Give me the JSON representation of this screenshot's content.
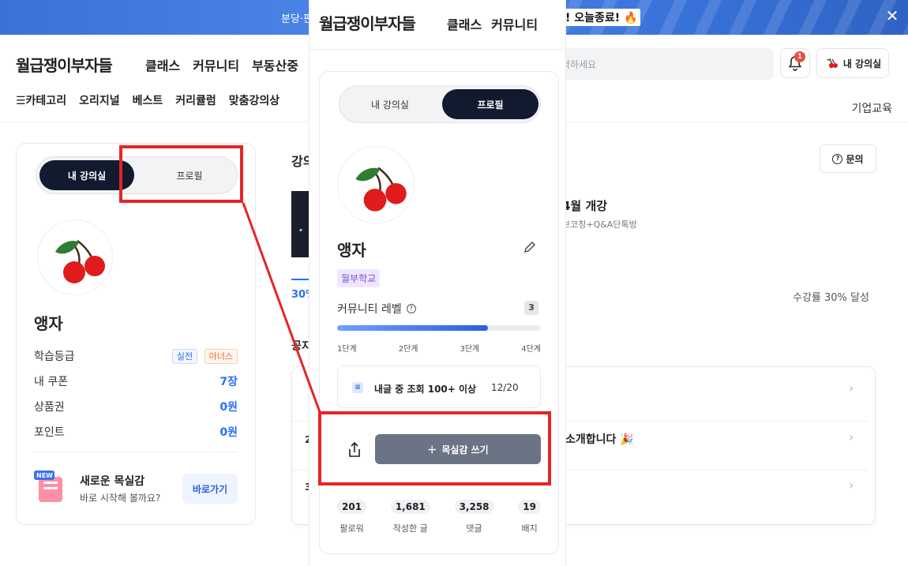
{
  "banner": {
    "left_text": "분당·판",
    "right_text": "! 오늘종료! 🔥",
    "close_label": "✕"
  },
  "header": {
    "logo": "월급쟁이부자들",
    "nav": [
      "클래스",
      "커뮤니티",
      "부동산중"
    ],
    "search_placeholder": "입력하세요",
    "notif_count": "1",
    "myroom_label": "내 강의실"
  },
  "subnav": {
    "items": [
      "☰카테고리",
      "오리지널",
      "베스트",
      "커리큘럼",
      "맞춤강의상"
    ],
    "right": "기업교육"
  },
  "left_card": {
    "toggle": {
      "active": "내 강의실",
      "inactive": "프로필"
    },
    "name": "앵자",
    "rows": [
      {
        "label": "학습등급",
        "badges": [
          "실전",
          "아너스"
        ]
      },
      {
        "label": "내 쿠폰",
        "value": "7장"
      },
      {
        "label": "상품권",
        "value": "0원"
      },
      {
        "label": "포인트",
        "value": "0원"
      }
    ],
    "promo_title": "새로운 목실감",
    "promo_sub": "바로 시작해 볼까요?",
    "promo_button": "바로가기",
    "promo_badge": "NEW"
  },
  "background": {
    "section_title": "강의",
    "percent": "30%",
    "section2": "공지",
    "course_title": "4월 개강",
    "course_sub": "브코칭+Q&A단톡방",
    "progress_goal": "수강률 30% 달성",
    "inquiry_button": "문의",
    "list_item_text": "소개합니다 🎉",
    "list_nums": [
      "2",
      "3"
    ]
  },
  "mobile": {
    "logo": "월급쟁이부자들",
    "nav": [
      "클래스",
      "커뮤니티"
    ],
    "toggle": {
      "inactive": "내 강의실",
      "active": "프로필"
    },
    "name": "앵자",
    "school": "월부학교",
    "level_label": "커뮤니티 레벨",
    "level_value": "3",
    "level_progress": 0.74,
    "steps": [
      "1단계",
      "2단계",
      "3단계",
      "4단계"
    ],
    "quest_text": "내글 중 조회 100+ 이상",
    "quest_count": "12/20",
    "write_button": "목실감 쓰기",
    "stats": [
      {
        "num": "201",
        "label": "팔로워"
      },
      {
        "num": "1,681",
        "label": "작성한 글"
      },
      {
        "num": "3,258",
        "label": "댓글"
      },
      {
        "num": "19",
        "label": "배지"
      }
    ]
  },
  "colors": {
    "accent": "#2b6ff5",
    "dark_toggle": "#111a2e",
    "highlight": "#e52525",
    "write_button": "#6b7485"
  }
}
